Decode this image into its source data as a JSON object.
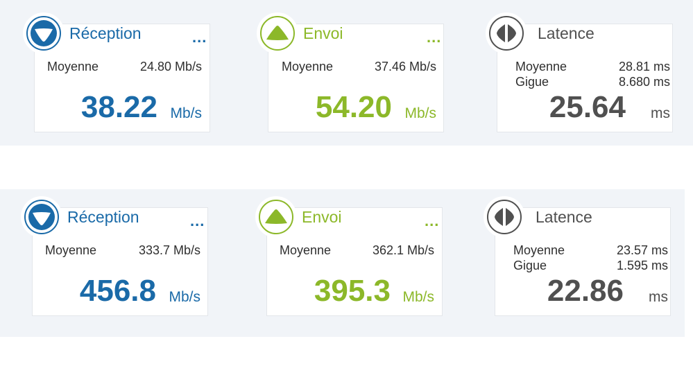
{
  "colors": {
    "download": "#1a6aa8",
    "upload": "#8cb829",
    "latency": "#505050"
  },
  "tests": [
    {
      "download": {
        "title": "Réception",
        "menu": "...",
        "avg_label": "Moyenne",
        "avg_value": "24.80 Mb/s",
        "value": "38.22",
        "unit": "Mb/s",
        "icon": "arrow-down-icon"
      },
      "upload": {
        "title": "Envoi",
        "menu": "...",
        "avg_label": "Moyenne",
        "avg_value": "37.46 Mb/s",
        "value": "54.20",
        "unit": "Mb/s",
        "icon": "arrow-up-icon"
      },
      "latency": {
        "title": "Latence",
        "avg_label": "Moyenne",
        "avg_value": "28.81 ms",
        "jitter_label": "Gigue",
        "jitter_value": "8.680 ms",
        "value": "25.64",
        "unit": "ms",
        "icon": "latency-arrows-icon"
      }
    },
    {
      "download": {
        "title": "Réception",
        "menu": "...",
        "avg_label": "Moyenne",
        "avg_value": "333.7 Mb/s",
        "value": "456.8",
        "unit": "Mb/s",
        "icon": "arrow-down-icon"
      },
      "upload": {
        "title": "Envoi",
        "menu": "...",
        "avg_label": "Moyenne",
        "avg_value": "362.1 Mb/s",
        "value": "395.3",
        "unit": "Mb/s",
        "icon": "arrow-up-icon"
      },
      "latency": {
        "title": "Latence",
        "avg_label": "Moyenne",
        "avg_value": "23.57 ms",
        "jitter_label": "Gigue",
        "jitter_value": "1.595 ms",
        "value": "22.86",
        "unit": "ms",
        "icon": "latency-arrows-icon"
      }
    }
  ]
}
